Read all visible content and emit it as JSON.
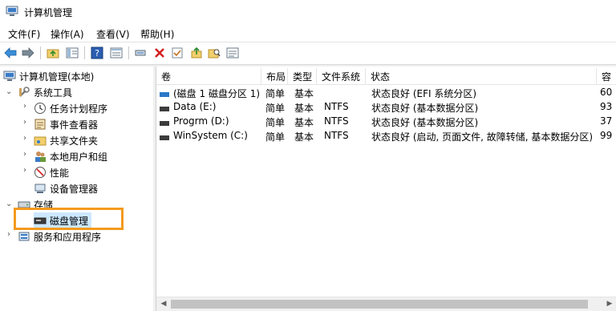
{
  "window": {
    "title": "计算机管理"
  },
  "menu": {
    "file": "文件(F)",
    "action": "操作(A)",
    "view": "查看(V)",
    "help": "帮助(H)"
  },
  "tree": {
    "root": "计算机管理(本地)",
    "system_tools": "系统工具",
    "task_scheduler": "任务计划程序",
    "event_viewer": "事件查看器",
    "shared_folders": "共享文件夹",
    "local_users": "本地用户和组",
    "performance": "性能",
    "device_manager": "设备管理器",
    "storage": "存储",
    "disk_management": "磁盘管理",
    "services_apps": "服务和应用程序"
  },
  "table": {
    "columns": [
      "卷",
      "布局",
      "类型",
      "文件系统",
      "状态",
      "容"
    ],
    "rows": [
      {
        "volume": "(磁盘 1 磁盘分区 1)",
        "layout": "简单",
        "type": "基本",
        "fs": "",
        "status": "状态良好 (EFI 系统分区)",
        "cap": "60"
      },
      {
        "volume": "Data (E:)",
        "layout": "简单",
        "type": "基本",
        "fs": "NTFS",
        "status": "状态良好 (基本数据分区)",
        "cap": "93"
      },
      {
        "volume": "Progrm (D:)",
        "layout": "简单",
        "type": "基本",
        "fs": "NTFS",
        "status": "状态良好 (基本数据分区)",
        "cap": "37"
      },
      {
        "volume": "WinSystem (C:)",
        "layout": "简单",
        "type": "基本",
        "fs": "NTFS",
        "status": "状态良好 (启动, 页面文件, 故障转储, 基本数据分区)",
        "cap": "99"
      }
    ]
  },
  "colors": {
    "highlight_box": "#f39a1e",
    "selection": "#cce8ff"
  }
}
